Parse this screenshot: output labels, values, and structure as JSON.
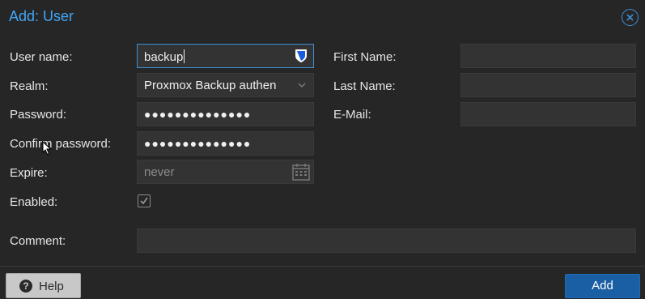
{
  "dialog": {
    "title": "Add: User",
    "close_icon": "close-circle-icon"
  },
  "left": {
    "username": {
      "label": "User name:",
      "value": "backup",
      "icon": "bitwarden-shield-icon"
    },
    "realm": {
      "label": "Realm:",
      "value": "Proxmox Backup authen",
      "icon": "chevron-down-icon"
    },
    "password": {
      "label": "Password:",
      "value": "●●●●●●●●●●●●●●"
    },
    "confirm_password": {
      "label": "Confirm password:",
      "value": "●●●●●●●●●●●●●●"
    },
    "expire": {
      "label": "Expire:",
      "placeholder": "never",
      "icon": "calendar-icon"
    },
    "enabled": {
      "label": "Enabled:",
      "checked": true
    }
  },
  "right": {
    "first_name": {
      "label": "First Name:",
      "value": ""
    },
    "last_name": {
      "label": "Last Name:",
      "value": ""
    },
    "email": {
      "label": "E-Mail:",
      "value": ""
    }
  },
  "comment": {
    "label": "Comment:",
    "value": ""
  },
  "footer": {
    "help_label": "Help",
    "help_icon": "question-circle-icon",
    "add_label": "Add"
  },
  "colors": {
    "background": "#262626",
    "field": "#333333",
    "title": "#42a5f5",
    "focus": "#3d8fd6",
    "primary_button": "#1a5fa3"
  }
}
